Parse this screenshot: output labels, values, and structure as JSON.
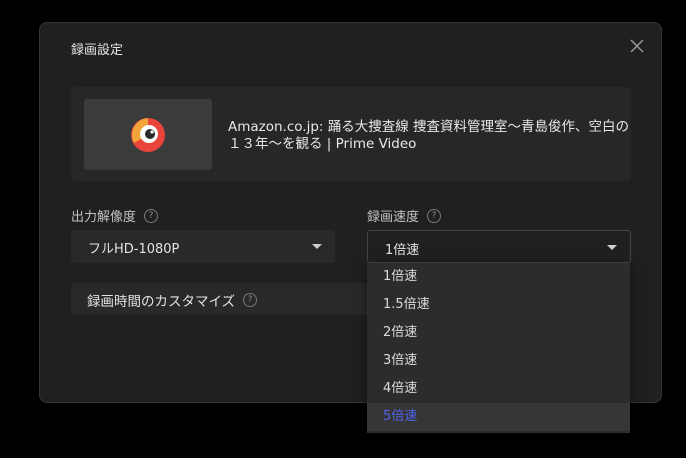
{
  "dialog": {
    "title": "録画設定"
  },
  "video": {
    "title": "Amazon.co.jp: 踊る大捜査線 捜査資料管理室～青島俊作、空白の１３年～を観る | Prime Video"
  },
  "output_resolution": {
    "label": "出力解像度",
    "value": "フルHD-1080P"
  },
  "recording_speed": {
    "label": "録画速度",
    "value": "1倍速",
    "options": [
      "1倍速",
      "1.5倍速",
      "2倍速",
      "3倍速",
      "4倍速",
      "5倍速"
    ],
    "highlighted": "5倍速"
  },
  "custom_time": {
    "label": "録画時間のカスタマイズ"
  },
  "help_glyph": "?",
  "colors": {
    "accent": "#4f63e8",
    "background": "#202020",
    "backdrop": "#000000"
  }
}
